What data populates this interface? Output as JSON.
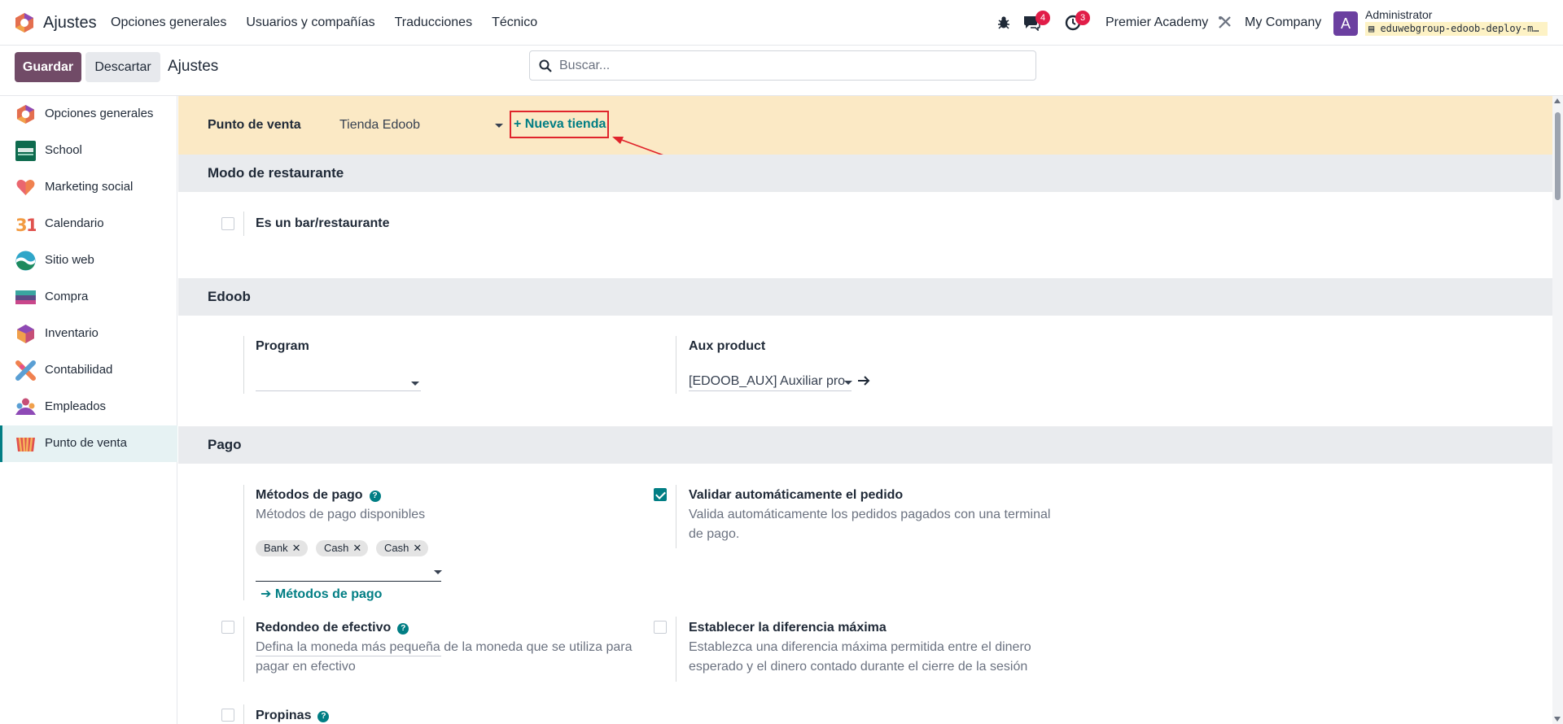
{
  "topbar": {
    "app_name": "Ajustes",
    "menu": [
      "Opciones generales",
      "Usuarios y compañías",
      "Traducciones",
      "Técnico"
    ],
    "messages_count": "4",
    "activities_count": "3",
    "company_switch": "Premier Academy",
    "company": "My Company",
    "avatar_letter": "A",
    "user_name": "Administrator",
    "database": "eduwebgroup-edoob-deploy-m…"
  },
  "control": {
    "save_label": "Guardar",
    "discard_label": "Descartar",
    "breadcrumb": "Ajustes",
    "search_placeholder": "Buscar..."
  },
  "sidebar": {
    "items": [
      {
        "label": "Opciones generales",
        "icon": "odoo-logo-icon"
      },
      {
        "label": "School",
        "icon": "school-icon"
      },
      {
        "label": "Marketing social",
        "icon": "heart-icon"
      },
      {
        "label": "Calendario",
        "icon": "calendar-icon"
      },
      {
        "label": "Sitio web",
        "icon": "website-icon"
      },
      {
        "label": "Compra",
        "icon": "purchase-icon"
      },
      {
        "label": "Inventario",
        "icon": "inventory-icon"
      },
      {
        "label": "Contabilidad",
        "icon": "accounting-icon"
      },
      {
        "label": "Empleados",
        "icon": "employees-icon"
      },
      {
        "label": "Punto de venta",
        "icon": "pos-icon"
      }
    ],
    "active_index": 9
  },
  "pos": {
    "label": "Punto de venta",
    "selected_shop": "Tienda Edoob",
    "new_shop": "+ Nueva tienda"
  },
  "restaurant": {
    "section_title": "Modo de restaurante",
    "is_bar_label": "Es un bar/restaurante",
    "is_bar_checked": false
  },
  "edoob": {
    "section_title": "Edoob",
    "program_label": "Program",
    "program_value": "",
    "aux_label": "Aux product",
    "aux_value": "[EDOOB_AUX] Auxiliar pro"
  },
  "payment": {
    "section_title": "Pago",
    "methods_title": "Métodos de pago",
    "methods_desc": "Métodos de pago disponibles",
    "methods_tags": [
      "Bank",
      "Cash",
      "Cash"
    ],
    "methods_link": "Métodos de pago",
    "auto_validate_title": "Validar automáticamente el pedido",
    "auto_validate_desc": "Valida automáticamente los pedidos pagados con una terminal de pago.",
    "auto_validate_checked": true,
    "rounding_title": "Redondeo de efectivo",
    "rounding_desc": "Defina la moneda más pequeña de la moneda que se utiliza para pagar en efectivo",
    "max_diff_title": "Establecer la diferencia máxima",
    "max_diff_desc": "Establezca una diferencia máxima permitida entre el dinero esperado y el dinero contado durante el cierre de la sesión",
    "tips_title": "Propinas"
  },
  "colors": {
    "brand": "#714b67",
    "accent": "#017e84",
    "highlight_border": "#e0242c",
    "pos_header_bg": "#fbe9c5"
  }
}
